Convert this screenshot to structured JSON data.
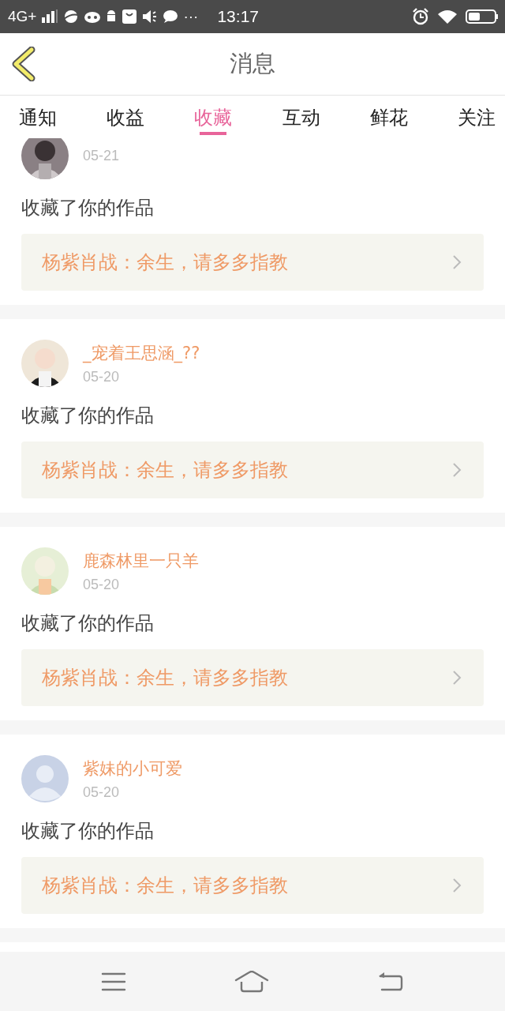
{
  "status_bar": {
    "network": "4G+",
    "more": "···",
    "time": "13:17"
  },
  "header": {
    "title": "消息"
  },
  "tabs": [
    {
      "label": "通知",
      "selected": false
    },
    {
      "label": "收益",
      "selected": false
    },
    {
      "label": "收藏",
      "selected": true
    },
    {
      "label": "互动",
      "selected": false
    },
    {
      "label": "鲜花",
      "selected": false
    },
    {
      "label": "关注",
      "selected": false
    }
  ],
  "messages": [
    {
      "date": "05-21",
      "action": "收藏了你的作品",
      "work": "杨紫肖战：余生，请多多指教"
    },
    {
      "user": "_宠着王思涵_??",
      "date": "05-20",
      "action": "收藏了你的作品",
      "work": "杨紫肖战：余生，请多多指教"
    },
    {
      "user": "鹿森林里一只羊",
      "date": "05-20",
      "action": "收藏了你的作品",
      "work": "杨紫肖战：余生，请多多指教"
    },
    {
      "avatar": {
        "kind": "default"
      },
      "user": "紫妹的小可爱",
      "date": "05-20",
      "action": "收藏了你的作品",
      "work": "杨紫肖战：余生，请多多指教"
    }
  ]
}
